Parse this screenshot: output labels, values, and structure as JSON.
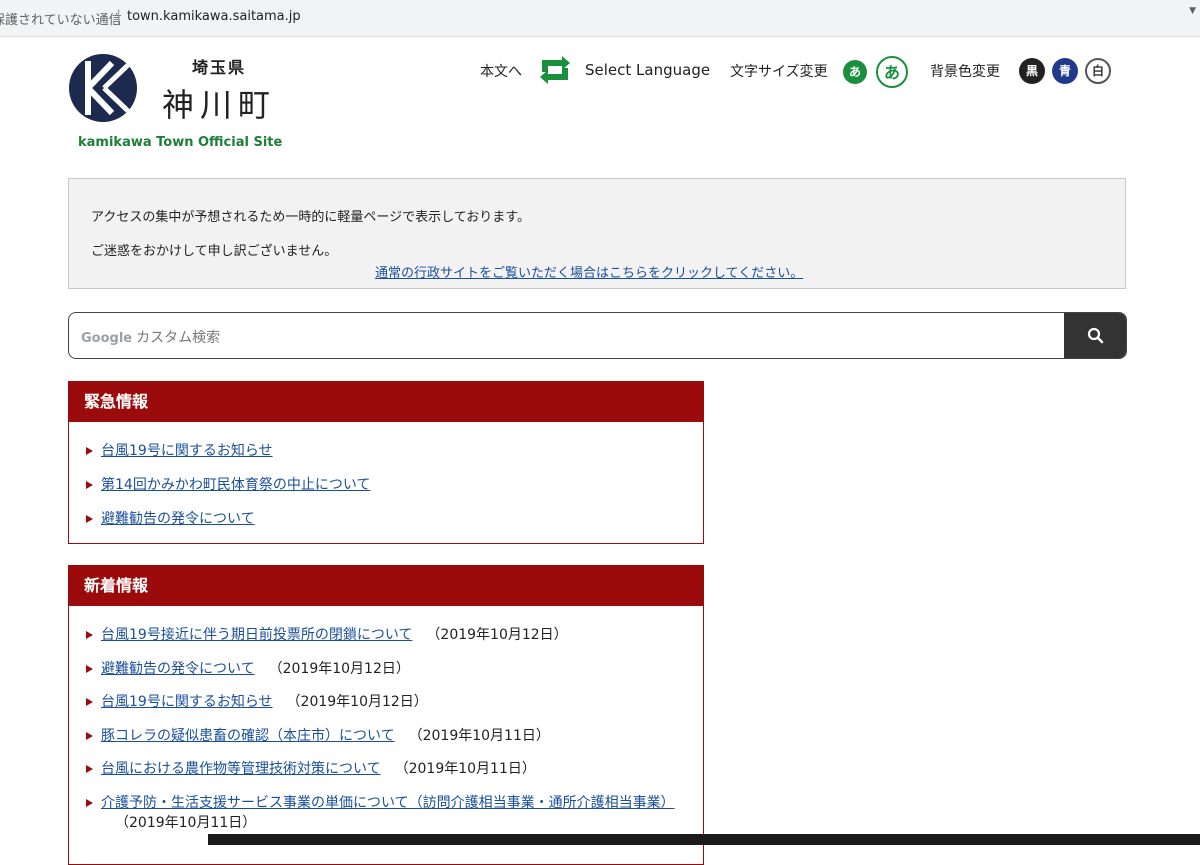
{
  "browser": {
    "security_text": "保護されていない通信",
    "url": "town.kamikawa.saitama.jp"
  },
  "header": {
    "prefecture": "埼玉県",
    "town_name": "神川町",
    "site_subtitle": "kamikawa Town Official Site",
    "logo_letters": "KK",
    "to_main": "本文へ",
    "select_language": "Select Language",
    "font_size_label": "文字サイズ変更",
    "font_small": "あ",
    "font_large": "あ",
    "bg_label": "背景色変更",
    "bg_black": "黒",
    "bg_blue": "青",
    "bg_white": "白"
  },
  "notice": {
    "line1": "アクセスの集中が予想されるため一時的に軽量ページで表示しております。",
    "line2": "ご迷惑をおかけして申し訳ございません。",
    "link": "通常の行政サイトをご覧いただく場合はこちらをクリックしてください。"
  },
  "search": {
    "google_label": "Google",
    "placeholder": "カスタム検索",
    "button_icon": "search-icon"
  },
  "emergency": {
    "title": "緊急情報",
    "items": [
      {
        "label": "台風19号に関するお知らせ"
      },
      {
        "label": "第14回かみかわ町民体育祭の中止について"
      },
      {
        "label": "避難勧告の発令について"
      }
    ]
  },
  "news": {
    "title": "新着情報",
    "items": [
      {
        "label": "台風19号接近に伴う期日前投票所の閉鎖について",
        "date": "（2019年10月12日）"
      },
      {
        "label": "避難勧告の発令について",
        "date": "（2019年10月12日）"
      },
      {
        "label": "台風19号に関するお知らせ",
        "date": "（2019年10月12日）"
      },
      {
        "label": "豚コレラの疑似患畜の確認（本庄市）について",
        "date": "（2019年10月11日）"
      },
      {
        "label": "台風における農作物等管理技術対策について",
        "date": "（2019年10月11日）"
      },
      {
        "label": "介護予防・生活支援サービス事業の単価について（訪問介護相当事業・通所介護相当事業）",
        "date": "（2019年10月11日）"
      }
    ]
  },
  "colors": {
    "accent_green": "#1a8f3c",
    "panel_red": "#9c0b0b",
    "link_blue": "#1a4f9c",
    "logo_navy": "#1c2a4d"
  }
}
